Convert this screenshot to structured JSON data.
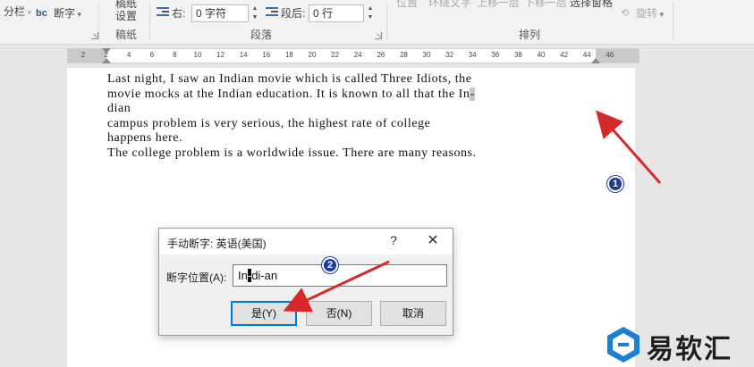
{
  "ribbon": {
    "break_btn": "分栏",
    "hyphen_btn": "断字",
    "manuscript_line1": "稿纸",
    "manuscript_line2": "设置",
    "manuscript_group": "稿纸",
    "indent_right_label": "右:",
    "indent_right_value": "0 字符",
    "spacing_after_label": "段后:",
    "spacing_after_value": "0 行",
    "paragraph_group": "段落",
    "position_btn": "位置",
    "wrap_btn": "环绕文字",
    "bring_forward_btn": "上移一层",
    "send_backward_btn": "下移一层",
    "selection_pane_btn": "选择窗格",
    "rotate_btn": "旋转",
    "arrange_group": "排列"
  },
  "ruler": {
    "ticks": [
      "2",
      "2",
      "4",
      "6",
      "8",
      "10",
      "12",
      "14",
      "16",
      "18",
      "20",
      "22",
      "24",
      "26",
      "28",
      "30",
      "32",
      "34",
      "36",
      "38",
      "40",
      "42",
      "44",
      "46"
    ]
  },
  "document": {
    "line1": "Last night, I saw an Indian movie which is called Three Idiots, the",
    "line2_a": "movie mocks at the Indian education. It is known to all that the In",
    "line2_hyphen": "-",
    "line3": "dian",
    "line4": "campus problem is very serious, the highest rate of college",
    "line5": "happens here.",
    "line6": "The college problem is a worldwide issue. There are many reasons."
  },
  "dialog": {
    "title": "手动断字: 英语(美国)",
    "help": "?",
    "close": "✕",
    "position_label": "断字位置(A):",
    "value_pre": "In",
    "value_sel": "-",
    "value_post": "di-an",
    "yes_btn": "是(Y)",
    "no_btn": "否(N)",
    "cancel_btn": "取消"
  },
  "annotations": {
    "badge1": "1",
    "badge2": "2",
    "arrow_color": "#d62a2a"
  },
  "watermark": {
    "text": "易软汇"
  }
}
